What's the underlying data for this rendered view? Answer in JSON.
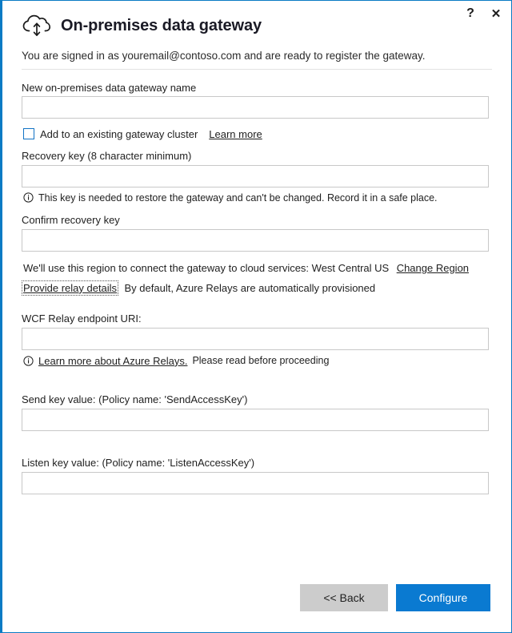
{
  "window": {
    "help_label": "?",
    "close_label": "✕",
    "help_icon": "question-mark-icon",
    "close_icon": "close-icon"
  },
  "header": {
    "icon": "cloud-with-up-down-arrow-icon",
    "title": "On-premises data gateway",
    "signed_in_text": "You are signed in as youremail@contoso.com and are ready to register the gateway."
  },
  "form": {
    "gateway_name": {
      "label": "New on-premises data gateway name",
      "value": "",
      "placeholder": ""
    },
    "cluster_checkbox": {
      "label": "Add to an existing gateway cluster",
      "checked": false,
      "learn_more_label": "Learn more"
    },
    "recovery_key": {
      "label": "Recovery key (8 character minimum)",
      "value": "",
      "placeholder": "",
      "info": "This key is needed to restore the gateway and can't be changed. Record it in a safe place."
    },
    "confirm_recovery_key": {
      "label": "Confirm recovery key",
      "value": "",
      "placeholder": ""
    },
    "region": {
      "text": "We'll use this region to connect the gateway to cloud services: West Central US",
      "region_value": "West Central US",
      "change_link_label": "Change Region"
    },
    "relay": {
      "provide_link_label": "Provide relay details",
      "default_text": "By default, Azure Relays are automatically provisioned"
    },
    "wcf_relay_uri": {
      "label": "WCF Relay endpoint URI:",
      "value": "",
      "placeholder": "",
      "info_link_label": "Learn more about Azure Relays.",
      "info_text": "Please read before proceeding"
    },
    "send_key": {
      "label": "Send key value: (Policy name: 'SendAccessKey')",
      "value": "",
      "placeholder": ""
    },
    "listen_key": {
      "label": "Listen key value: (Policy name: 'ListenAccessKey')",
      "value": "",
      "placeholder": ""
    }
  },
  "footer": {
    "back_label": "<< Back",
    "configure_label": "Configure"
  },
  "colors": {
    "accent_border": "#0a7bc4",
    "primary_button": "#0a7ad1",
    "secondary_button": "#cccccc",
    "checkbox_border": "#1273c4",
    "input_border": "#c8c8c8",
    "text": "#1f1f1f"
  }
}
